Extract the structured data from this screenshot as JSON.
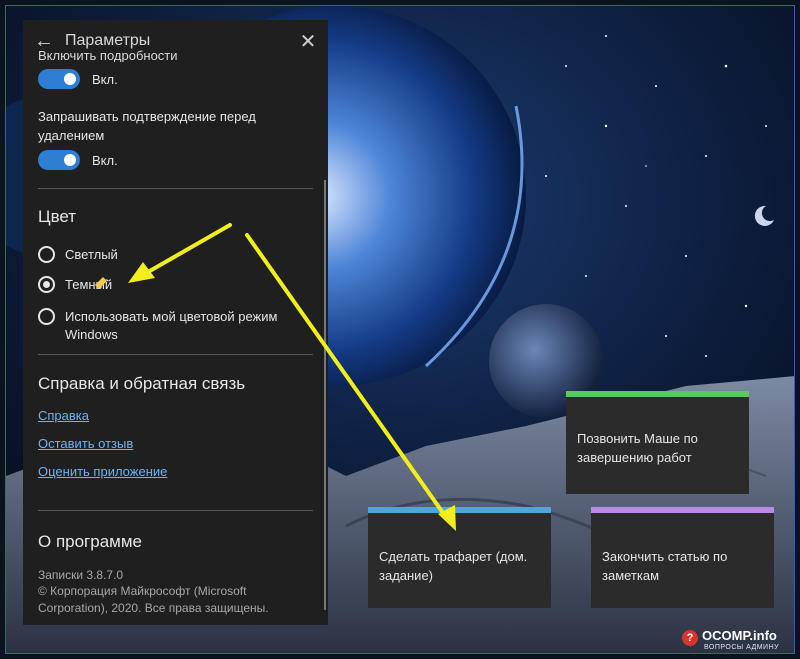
{
  "panel": {
    "title": "Параметры",
    "cut_label": "Включить подробности",
    "toggle1_state": "Вкл.",
    "confirm_label": "Запрашивать подтверждение перед удалением",
    "toggle2_state": "Вкл.",
    "color_heading": "Цвет",
    "color_options": [
      {
        "label": "Светлый",
        "selected": false
      },
      {
        "label": "Темный",
        "selected": true
      },
      {
        "label": "Использовать мой цветовой режим Windows",
        "selected": false
      }
    ],
    "help_heading": "Справка и обратная связь",
    "links": [
      "Справка",
      "Оставить отзыв",
      "Оценить приложение"
    ],
    "about_heading": "О программе",
    "version": "Записки 3.8.7.0",
    "copyright": "© Корпорация Майкрософт (Microsoft Corporation), 2020. Все права защищены."
  },
  "notes": [
    {
      "text": "Позвонить Маше по завершению работ",
      "color": "#5cc85c"
    },
    {
      "text": "Сделать трафарет (дом. задание)",
      "color": "#4aa9d8"
    },
    {
      "text": "Закончить статью по заметкам",
      "color": "#b98ae8"
    }
  ],
  "watermark": {
    "name": "OCOMP.info",
    "tagline": "ВОПРОСЫ АДМИНУ"
  },
  "colors": {
    "accent": "#2d7fd6",
    "arrow": "#f2ee1c",
    "link": "#6db3f5"
  },
  "icons": {
    "back": "back-arrow-icon",
    "close": "close-icon"
  }
}
